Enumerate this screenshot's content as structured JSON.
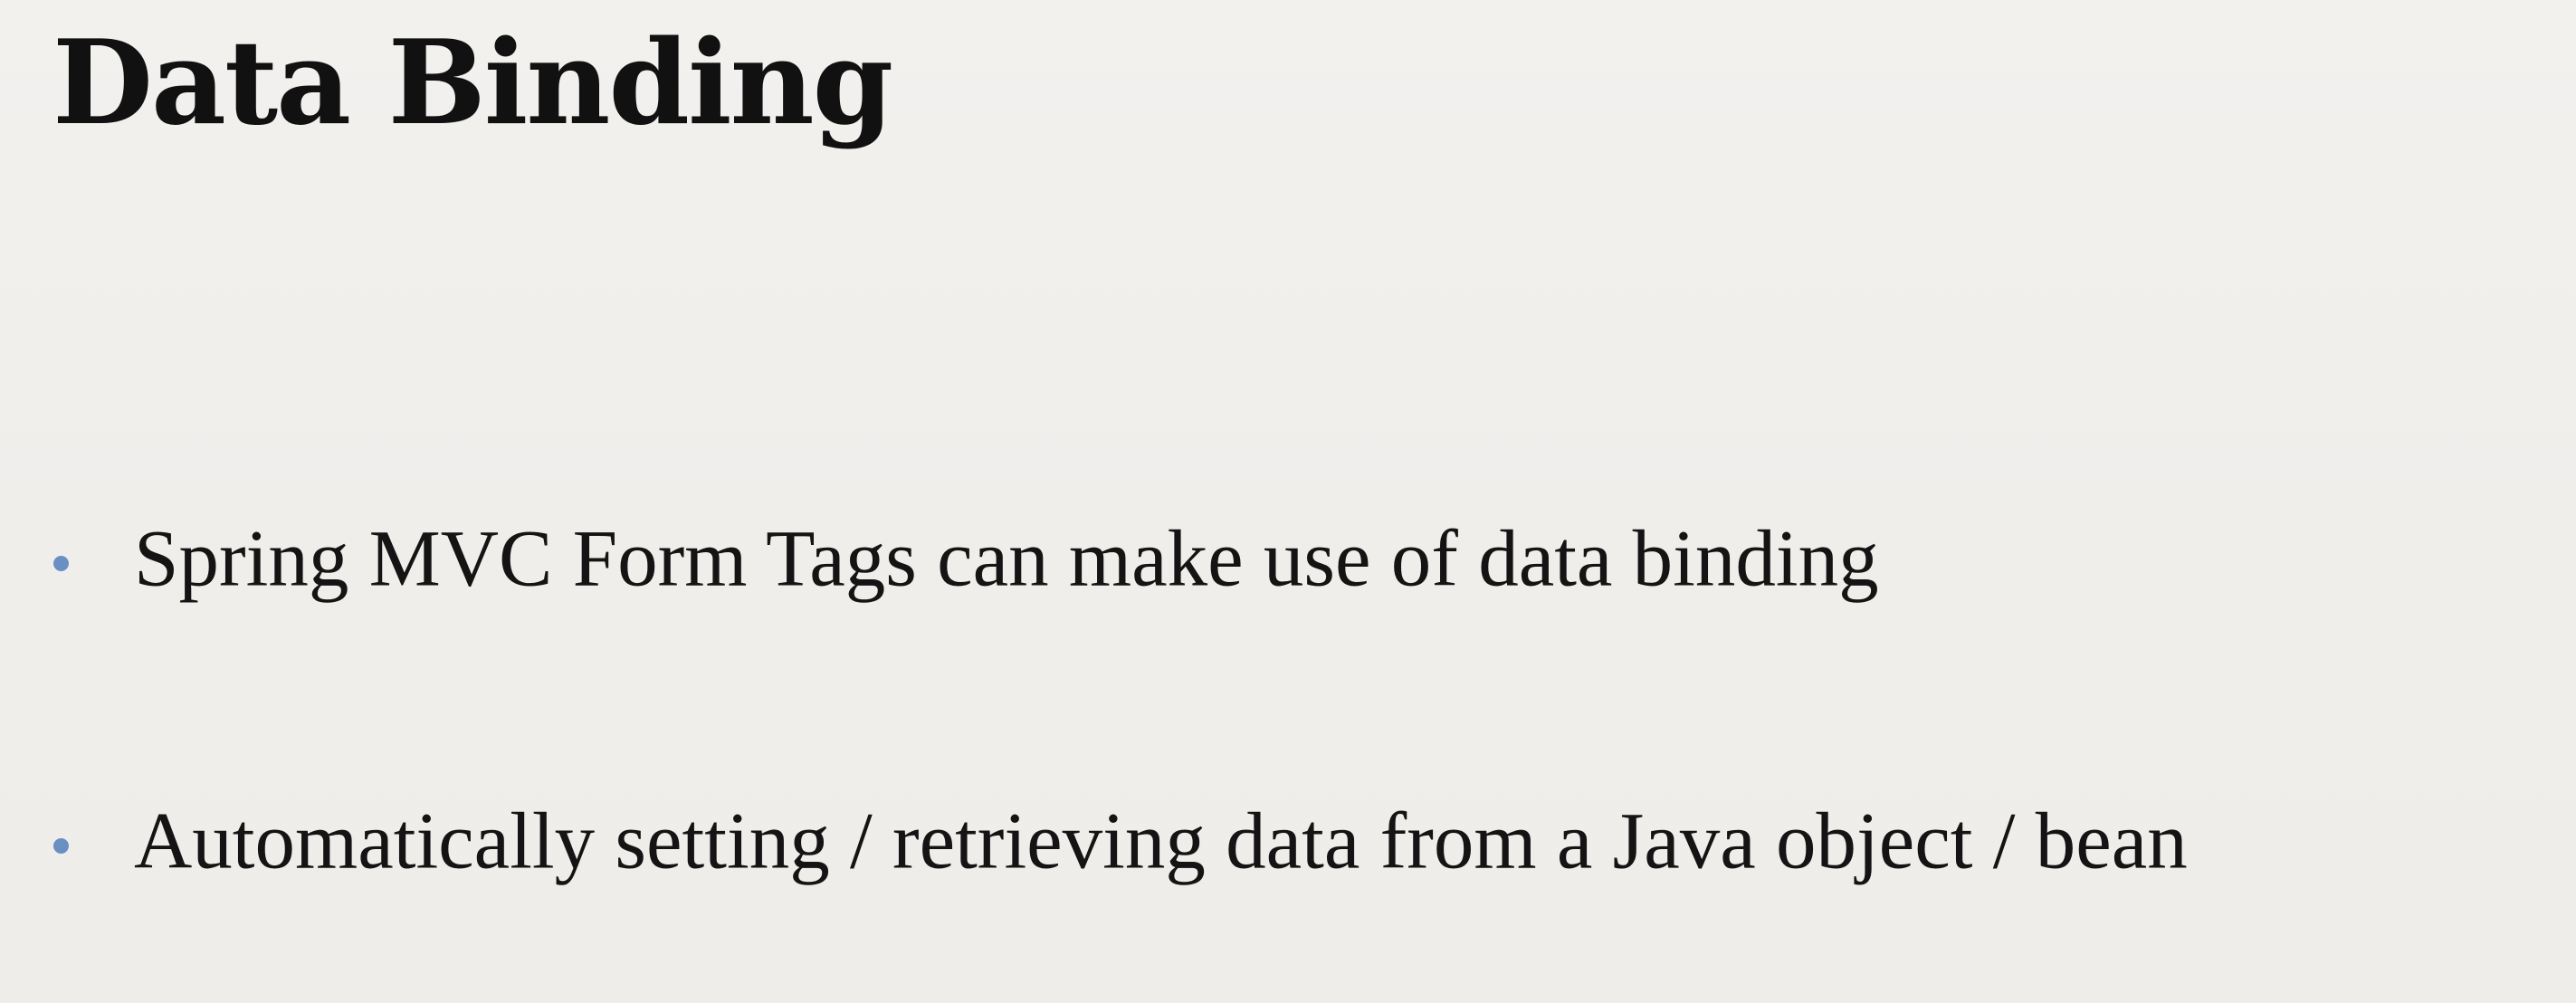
{
  "slide": {
    "title": "Data Binding",
    "bullets": [
      {
        "text": "Spring MVC Form Tags can make use of data binding"
      },
      {
        "text": "Automatically setting / retrieving data from a Java object / bean"
      }
    ]
  },
  "colors": {
    "background": "#f1efec",
    "title": "#111111",
    "text": "#141414",
    "bullet": "#6a8fc2"
  }
}
